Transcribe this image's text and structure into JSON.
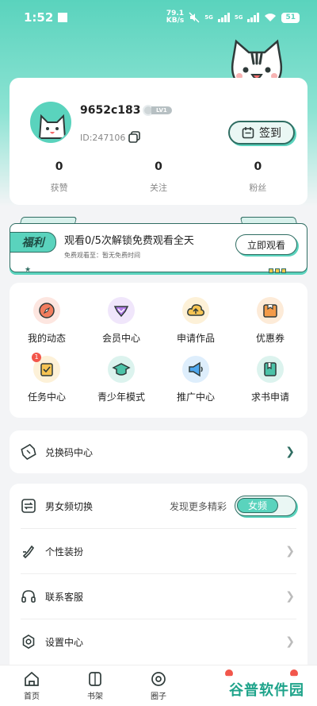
{
  "status_bar": {
    "time": "1:52",
    "net_speed_top": "79.1",
    "net_speed_bottom": "KB/s",
    "battery": "51",
    "net_label_1": "5G",
    "net_label_2": "5G"
  },
  "profile": {
    "username": "9652c183",
    "level": "LV1",
    "user_id": "ID:247106",
    "checkin_label": "签到",
    "stats": [
      {
        "num": "0",
        "label": "获赞"
      },
      {
        "num": "0",
        "label": "关注"
      },
      {
        "num": "0",
        "label": "粉丝"
      }
    ]
  },
  "welfare": {
    "tag": "福利",
    "title": "观看0/5次解锁免费观看全天",
    "subtitle": "免费观看至：暂无免费时间",
    "button": "立即观看"
  },
  "grid": {
    "items": [
      {
        "label": "我的动态",
        "icon": "compass-icon"
      },
      {
        "label": "会员中心",
        "icon": "vip-diamond-icon"
      },
      {
        "label": "申请作品",
        "icon": "upload-cloud-icon"
      },
      {
        "label": "优惠券",
        "icon": "coupon-icon"
      },
      {
        "label": "任务中心",
        "icon": "task-icon",
        "badge": "1"
      },
      {
        "label": "青少年模式",
        "icon": "graduation-cap-icon"
      },
      {
        "label": "推广中心",
        "icon": "megaphone-icon"
      },
      {
        "label": "求书申请",
        "icon": "book-request-icon"
      }
    ]
  },
  "redeem": {
    "label": "兑换码中心"
  },
  "settings": {
    "gender_label": "男女频切换",
    "gender_hint": "发现更多精彩",
    "gender_value": "女频",
    "personalize": "个性装扮",
    "support": "联系客服",
    "settings": "设置中心"
  },
  "nav": {
    "home": "首页",
    "shelf": "书架",
    "circle": "圈子"
  },
  "watermark": "谷普软件园",
  "colors": {
    "accent": "#5ad3bd",
    "dark": "#2f6d62",
    "badge": "#f2564b"
  }
}
